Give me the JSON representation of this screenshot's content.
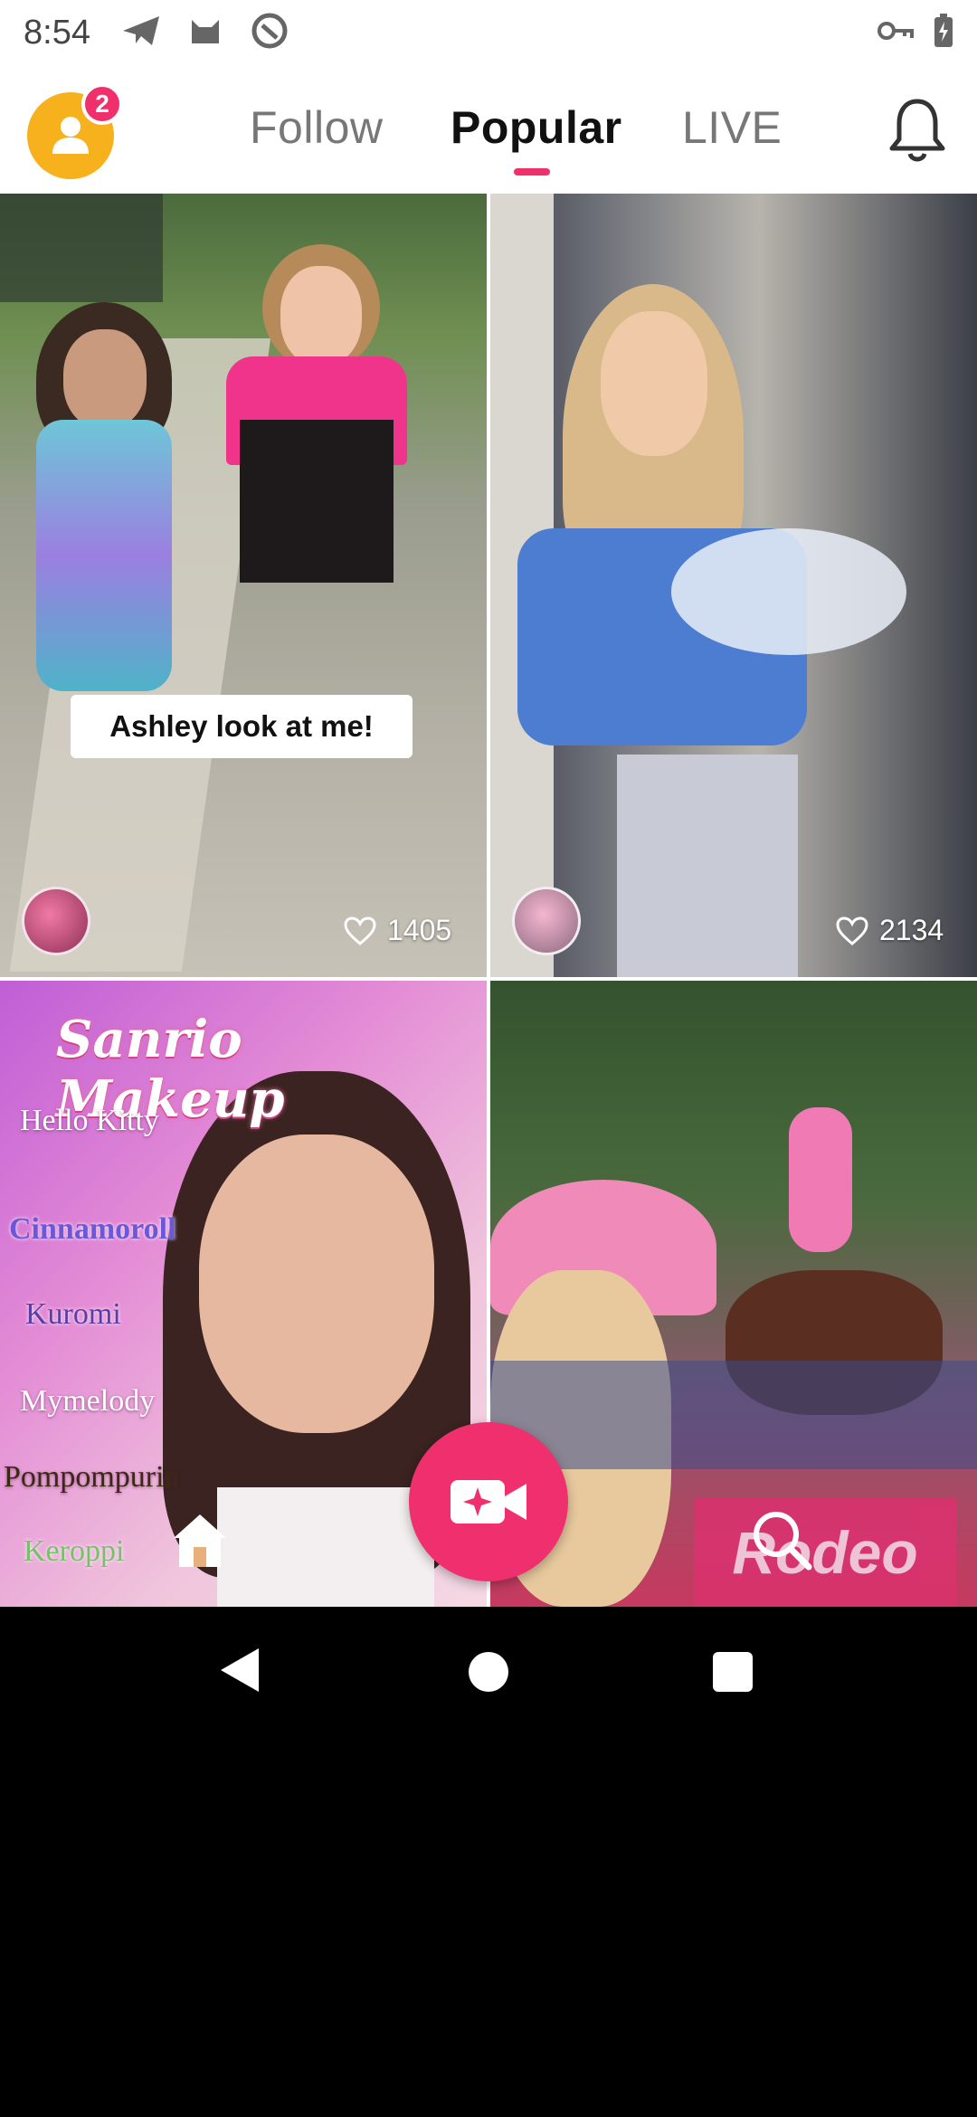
{
  "status_bar": {
    "time": "8:54",
    "left_icons": [
      "send-icon",
      "cat-icon",
      "at-sign-icon"
    ],
    "right_icons": [
      "key-icon",
      "battery-charging-icon"
    ]
  },
  "header": {
    "notification_count": "2",
    "tabs": [
      {
        "label": "Follow",
        "active": false
      },
      {
        "label": "Popular",
        "active": true
      },
      {
        "label": "LIVE",
        "active": false
      }
    ],
    "accent_color": "#f0306a"
  },
  "feed": {
    "tiles": [
      {
        "caption": "Ashley look at me!",
        "likes": "1405"
      },
      {
        "caption": "",
        "likes": "2134"
      },
      {
        "title": "Sanrio Makeup",
        "items": [
          "Hello Kitty",
          "Cinnamoroll",
          "Kuromi",
          "Mymelody",
          "Pompompurin",
          "Keroppi"
        ]
      },
      {
        "overlay_text": "Rodeo"
      }
    ]
  },
  "bottom": {
    "fab_icon": "video-camera-sparkle-icon",
    "fab_color": "#f02f6e",
    "home_icon": "home-icon",
    "search_icon": "search-icon"
  }
}
